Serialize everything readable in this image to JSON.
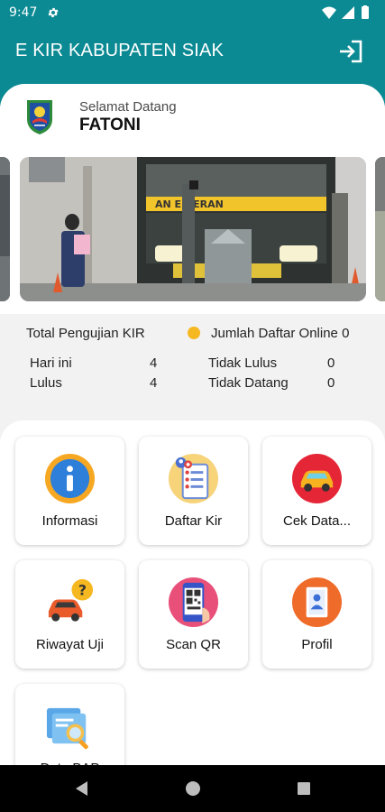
{
  "status_bar": {
    "time": "9:47",
    "icons": [
      "settings-icon",
      "wifi-icon",
      "signal-icon",
      "battery-icon"
    ]
  },
  "app_bar": {
    "title": "E KIR KABUPATEN SIAK",
    "action_icon": "logout-icon"
  },
  "header": {
    "greeting": "Selamat Datang",
    "username": "FATONI",
    "logo_icon": "kabupaten-siak-logo"
  },
  "banner": {
    "image": "vehicle-inspection-photo",
    "bus_sign_text": "AN EN ERAN"
  },
  "stats": {
    "total_label": "Total Pengujian KIR",
    "online_label": "Jumlah Daftar Online 0",
    "hari_ini_label": "Hari ini",
    "hari_ini_value": "4",
    "lulus_label": "Lulus",
    "lulus_value": "4",
    "tidak_lulus_label": "Tidak Lulus",
    "tidak_lulus_value": "0",
    "tidak_datang_label": "Tidak Datang",
    "tidak_datang_value": "0"
  },
  "menu": [
    {
      "label": "Informasi",
      "icon": "info-icon"
    },
    {
      "label": "Daftar Kir",
      "icon": "registration-icon"
    },
    {
      "label": "Cek Data...",
      "icon": "car-check-icon"
    },
    {
      "label": "Riwayat Uji",
      "icon": "history-question-icon"
    },
    {
      "label": "Scan QR",
      "icon": "qr-scan-icon"
    },
    {
      "label": "Profil",
      "icon": "profile-icon"
    },
    {
      "label": "Data BAP",
      "icon": "document-search-icon"
    }
  ],
  "colors": {
    "primary": "#0c8a93",
    "stat_dot": "#f6b821",
    "background": "#f2f2f2"
  },
  "nav_bar": {
    "icons": [
      "back-icon",
      "home-icon",
      "recents-icon"
    ]
  }
}
